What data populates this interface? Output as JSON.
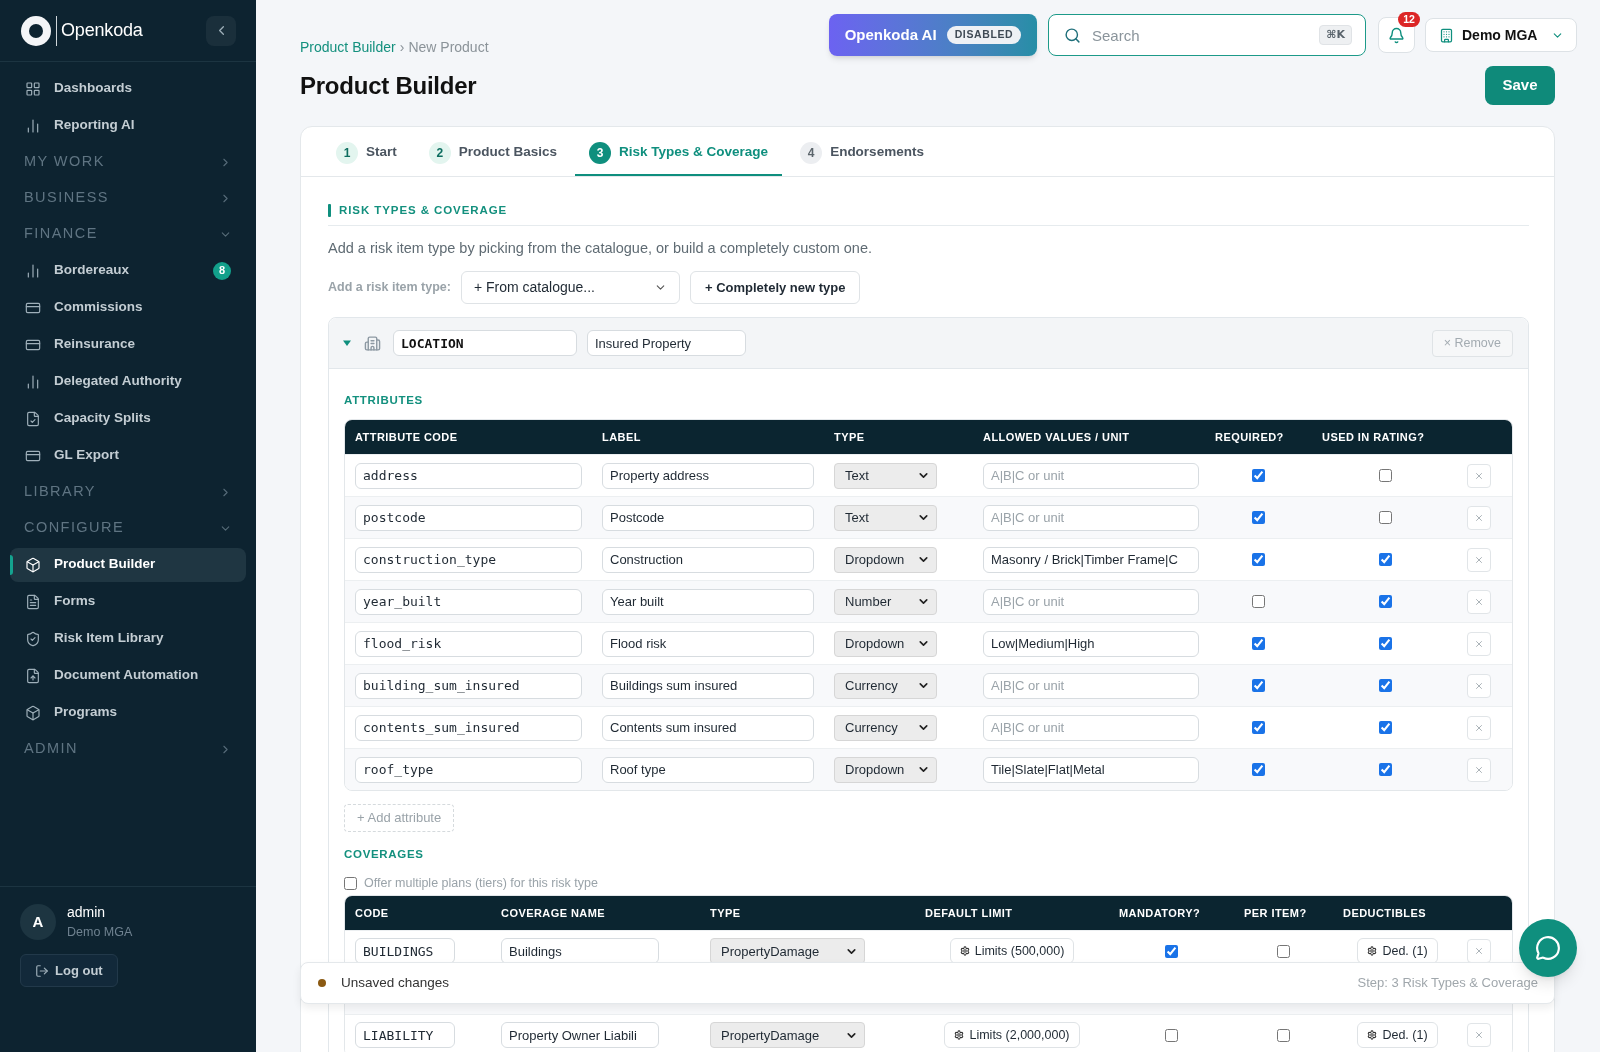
{
  "sidebar": {
    "logo": "Openkoda",
    "nav": [
      {
        "kind": "link",
        "label": "Dashboards",
        "selected": false
      },
      {
        "kind": "link",
        "label": "Reporting AI",
        "selected": false
      },
      {
        "kind": "section",
        "label": "MY WORK",
        "expanded": false
      },
      {
        "kind": "section",
        "label": "BUSINESS",
        "expanded": false
      },
      {
        "kind": "section",
        "label": "FINANCE",
        "expanded": true
      },
      {
        "kind": "link",
        "label": "Bordereaux",
        "selected": false,
        "badge": "8"
      },
      {
        "kind": "link",
        "label": "Commissions",
        "selected": false
      },
      {
        "kind": "link",
        "label": "Reinsurance",
        "selected": false
      },
      {
        "kind": "link",
        "label": "Delegated Authority",
        "selected": false
      },
      {
        "kind": "link",
        "label": "Capacity Splits",
        "selected": false
      },
      {
        "kind": "link",
        "label": "GL Export",
        "selected": false
      },
      {
        "kind": "section",
        "label": "LIBRARY",
        "expanded": false
      },
      {
        "kind": "section",
        "label": "CONFIGURE",
        "expanded": true
      },
      {
        "kind": "link",
        "label": "Product Builder",
        "selected": true
      },
      {
        "kind": "link",
        "label": "Forms",
        "selected": false
      },
      {
        "kind": "link",
        "label": "Risk Item Library",
        "selected": false
      },
      {
        "kind": "link",
        "label": "Document Automation",
        "selected": false
      },
      {
        "kind": "link",
        "label": "Programs",
        "selected": false
      },
      {
        "kind": "section",
        "label": "ADMIN",
        "expanded": false
      }
    ],
    "user": {
      "initial": "A",
      "name": "admin",
      "org": "Demo MGA"
    },
    "logout": "Log out"
  },
  "header": {
    "breadcrumb": [
      {
        "kind": "link",
        "label": "Product Builder"
      },
      {
        "kind": "current",
        "label": "New Product"
      }
    ],
    "breadcrumb_separator": "›",
    "title": "Product Builder",
    "ai_button": {
      "label": "Openkoda AI",
      "badge": "DISABLED"
    },
    "search": {
      "placeholder": "Search",
      "shortcut": "⌘K"
    },
    "notifications": {
      "count": "12"
    },
    "organization": "Demo MGA",
    "save": "Save"
  },
  "wizard": {
    "tabs": [
      {
        "number": "1",
        "label": "Start",
        "selected": false,
        "completed": true
      },
      {
        "number": "2",
        "label": "Product Basics",
        "selected": false,
        "completed": true
      },
      {
        "number": "3",
        "label": "Risk Types & Coverage",
        "selected": true,
        "completed": false
      },
      {
        "number": "4",
        "label": "Endorsements",
        "selected": false,
        "completed": false
      }
    ]
  },
  "section": {
    "heading": "RISK TYPES & COVERAGE",
    "description": "Add a risk item type by picking from the catalogue, or build a completely custom one.",
    "add_label": "Add a risk item type:",
    "catalogue_select": "+ From catalogue...",
    "new_type_button": "+ Completely new type"
  },
  "risk_types": [
    {
      "expanded": true,
      "code": "LOCATION",
      "name": "Insured Property",
      "remove": "× Remove",
      "attributes_heading": "ATTRIBUTES",
      "attribute_columns": [
        "ATTRIBUTE CODE",
        "LABEL",
        "TYPE",
        "ALLOWED VALUES / UNIT",
        "REQUIRED?",
        "USED IN RATING?"
      ],
      "attributes": [
        {
          "code": "address",
          "label": "Property address",
          "type": "Text",
          "placeholder": "A|B|C or unit",
          "required": true,
          "used_in_rating": false
        },
        {
          "code": "postcode",
          "label": "Postcode",
          "type": "Text",
          "placeholder": "A|B|C or unit",
          "required": true,
          "used_in_rating": false
        },
        {
          "code": "construction_type",
          "label": "Construction",
          "type": "Dropdown",
          "allowed_values": "Masonry / Brick|Timber Frame|C",
          "required": true,
          "used_in_rating": true
        },
        {
          "code": "year_built",
          "label": "Year built",
          "type": "Number",
          "placeholder": "A|B|C or unit",
          "required": false,
          "used_in_rating": true
        },
        {
          "code": "flood_risk",
          "label": "Flood risk",
          "type": "Dropdown",
          "allowed_values": "Low|Medium|High",
          "required": true,
          "used_in_rating": true
        },
        {
          "code": "building_sum_insured",
          "label": "Buildings sum insured",
          "type": "Currency",
          "placeholder": "A|B|C or unit",
          "required": true,
          "used_in_rating": true
        },
        {
          "code": "contents_sum_insured",
          "label": "Contents sum insured",
          "type": "Currency",
          "placeholder": "A|B|C or unit",
          "required": true,
          "used_in_rating": true
        },
        {
          "code": "roof_type",
          "label": "Roof type",
          "type": "Dropdown",
          "allowed_values": "Tile|Slate|Flat|Metal",
          "required": true,
          "used_in_rating": true
        }
      ],
      "add_attribute": "+ Add attribute",
      "coverages_heading": "COVERAGES",
      "tiers": {
        "label": "Offer multiple plans (tiers) for this risk type",
        "checked": false
      },
      "coverage_columns": [
        "CODE",
        "COVERAGE NAME",
        "TYPE",
        "DEFAULT LIMIT",
        "MANDATORY?",
        "PER ITEM?",
        "DEDUCTIBLES"
      ],
      "coverages": [
        {
          "kind": "row",
          "code": "BUILDINGS",
          "name": "Buildings",
          "type": "PropertyDamage",
          "limit": "Limits (500,000)",
          "mandatory": true,
          "per_item": false,
          "deductibles": "Ded. (1)"
        },
        {
          "kind": "covered"
        },
        {
          "kind": "row",
          "code": "LIABILITY",
          "name": "Property Owner Liabili",
          "type": "PropertyDamage",
          "limit": "Limits (2,000,000)",
          "mandatory": false,
          "per_item": false,
          "deductibles": "Ded. (1)"
        }
      ]
    }
  ],
  "footer": {
    "status": "Unsaved changes",
    "step": "Step: 3 Risk Types & Coverage"
  }
}
